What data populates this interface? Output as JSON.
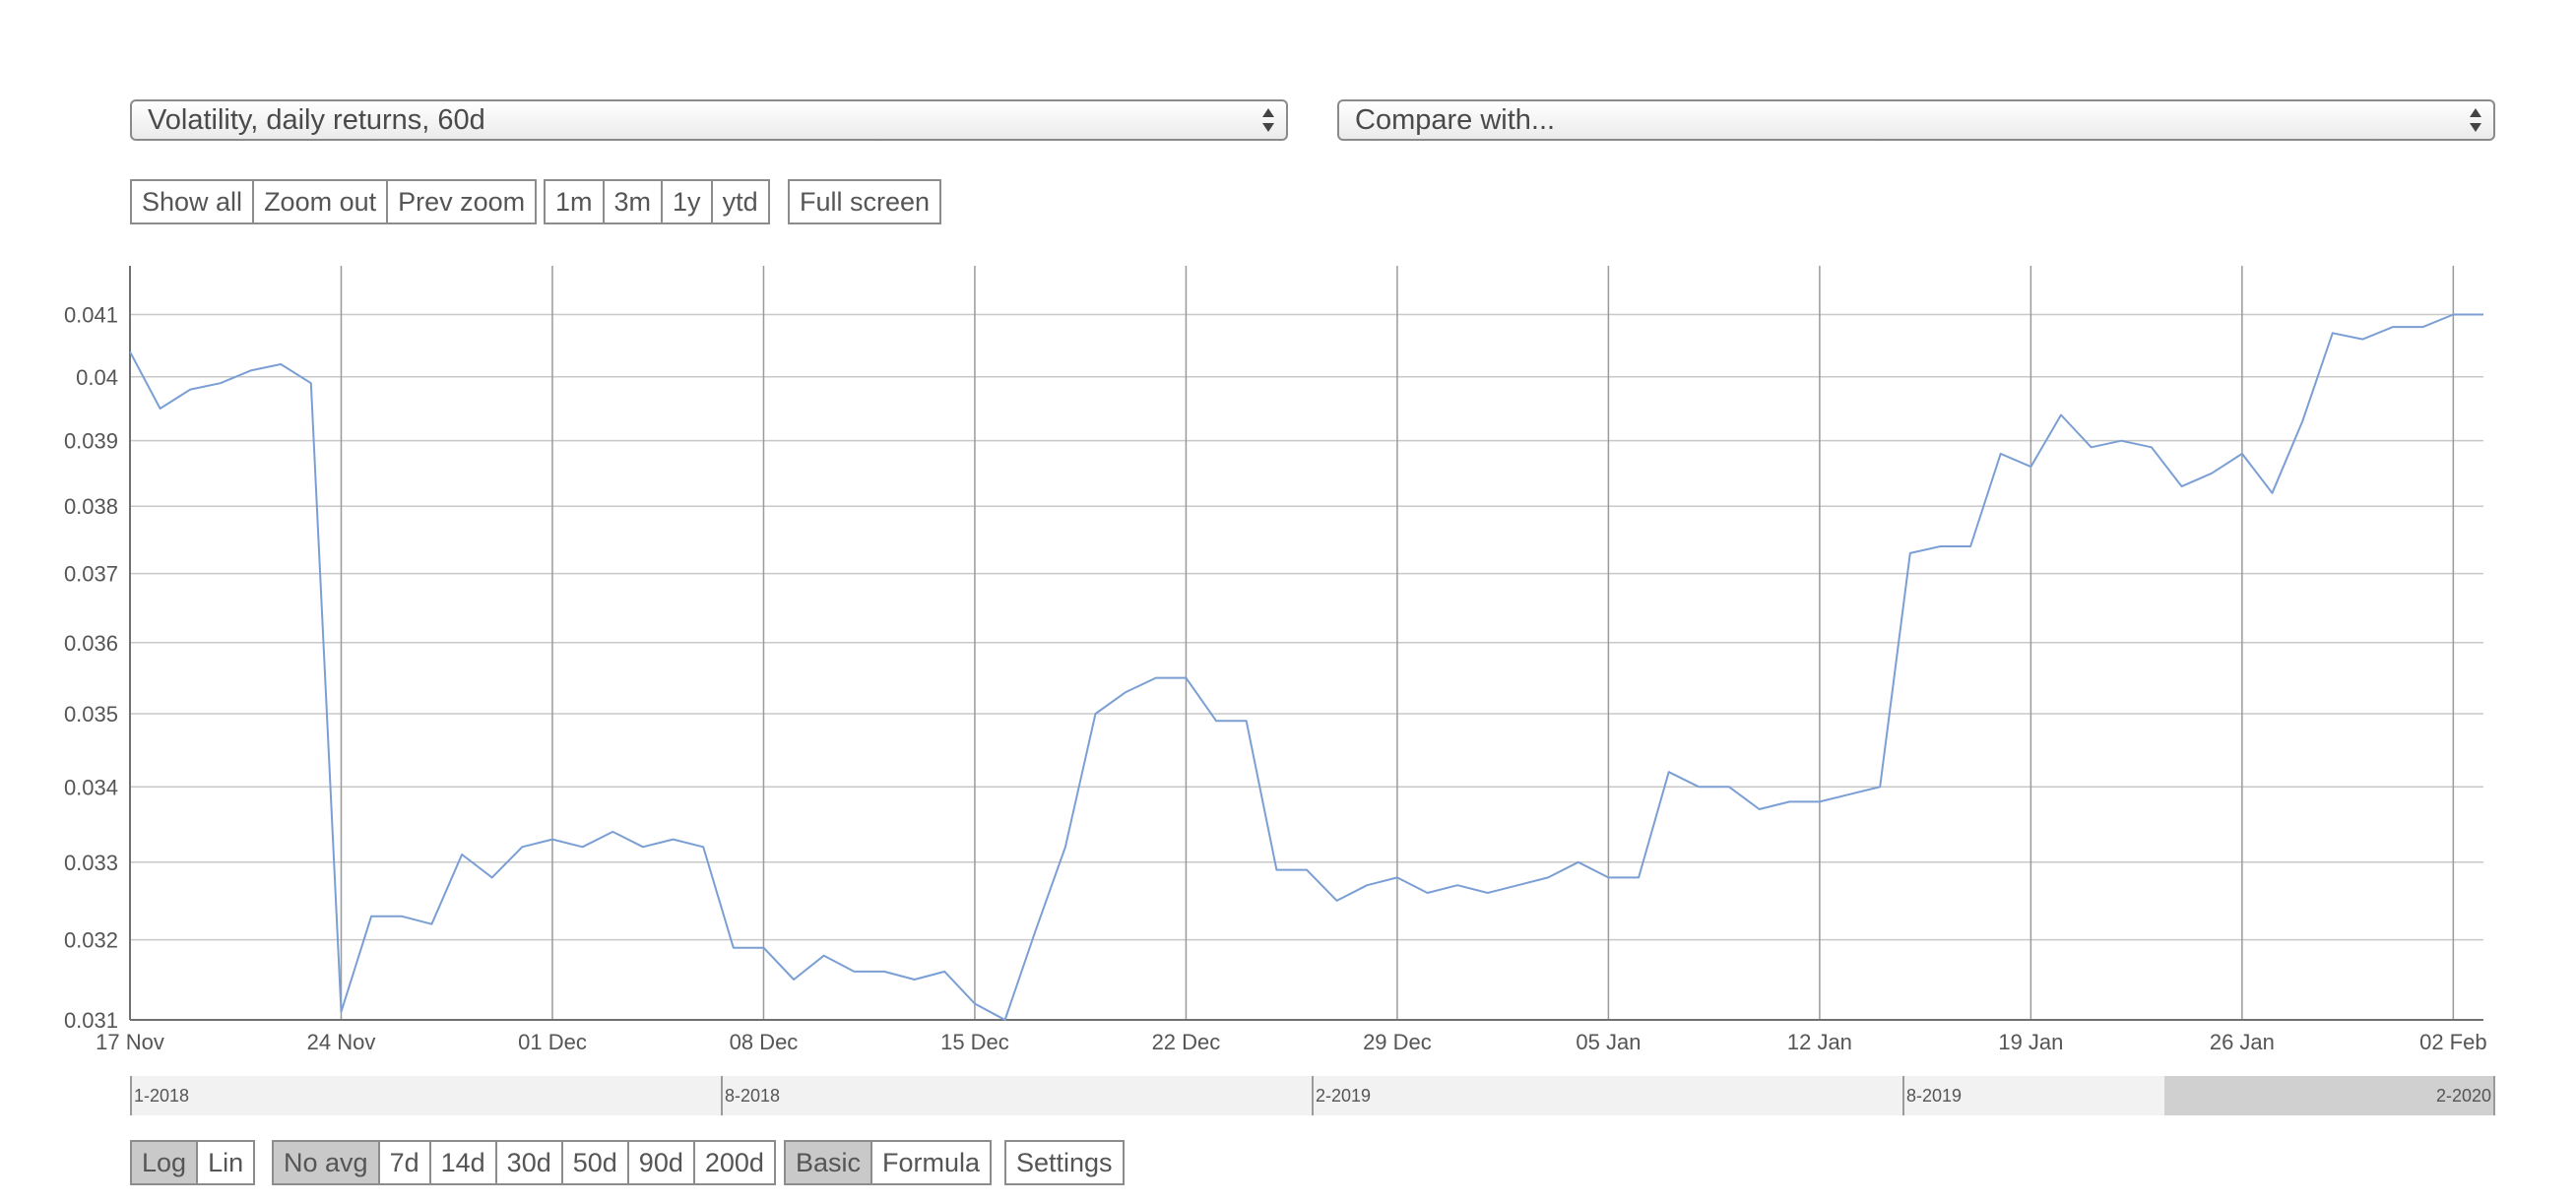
{
  "metric_select": {
    "value": "Volatility, daily returns, 60d"
  },
  "compare_select": {
    "value": "Compare with..."
  },
  "zoom_buttons": [
    "Show all",
    "Zoom out",
    "Prev zoom"
  ],
  "range_buttons": [
    "1m",
    "3m",
    "1y",
    "ytd"
  ],
  "fullscreen_button": "Full screen",
  "scale_buttons": [
    {
      "label": "Log",
      "active": true
    },
    {
      "label": "Lin",
      "active": false
    }
  ],
  "avg_buttons": [
    {
      "label": "No avg",
      "active": true
    },
    {
      "label": "7d",
      "active": false
    },
    {
      "label": "14d",
      "active": false
    },
    {
      "label": "30d",
      "active": false
    },
    {
      "label": "50d",
      "active": false
    },
    {
      "label": "90d",
      "active": false
    },
    {
      "label": "200d",
      "active": false
    }
  ],
  "mode_buttons": [
    {
      "label": "Basic",
      "active": true
    },
    {
      "label": "Formula",
      "active": false
    }
  ],
  "settings_button": "Settings",
  "navigator": {
    "labels": [
      "1-2018",
      "8-2018",
      "2-2019",
      "8-2019",
      "2-2020"
    ],
    "selection_fraction": [
      0.86,
      1.0
    ]
  },
  "colors": {
    "line": "#7b9fd4",
    "grid": "#c8c8c8",
    "selection": "#d0d0d0"
  },
  "chart_data": {
    "type": "line",
    "title": "",
    "xlabel": "",
    "ylabel": "",
    "y_scale": "log",
    "ylim": [
      0.031,
      0.0418
    ],
    "yticks": [
      0.031,
      0.032,
      0.033,
      0.034,
      0.035,
      0.036,
      0.037,
      0.038,
      0.039,
      0.04,
      0.041
    ],
    "ytick_labels": [
      "0.031",
      "0.032",
      "0.033",
      "0.034",
      "0.035",
      "0.036",
      "0.037",
      "0.038",
      "0.039",
      "0.04",
      "0.041"
    ],
    "xlim": [
      "2019-11-17",
      "2020-02-03"
    ],
    "xticks": [
      "2019-11-17",
      "2019-11-24",
      "2019-12-01",
      "2019-12-08",
      "2019-12-15",
      "2019-12-22",
      "2019-12-29",
      "2020-01-05",
      "2020-01-12",
      "2020-01-19",
      "2020-01-26",
      "2020-02-02"
    ],
    "xtick_labels": [
      "17 Nov",
      "24 Nov",
      "01 Dec",
      "08 Dec",
      "15 Dec",
      "22 Dec",
      "29 Dec",
      "05 Jan",
      "12 Jan",
      "19 Jan",
      "26 Jan",
      "02 Feb"
    ],
    "grid": true,
    "series": [
      {
        "x": [
          "2019-11-17",
          "2019-11-18",
          "2019-11-19",
          "2019-11-20",
          "2019-11-21",
          "2019-11-22",
          "2019-11-23",
          "2019-11-24",
          "2019-11-25",
          "2019-11-26",
          "2019-11-27",
          "2019-11-28",
          "2019-11-29",
          "2019-11-30",
          "2019-12-01",
          "2019-12-02",
          "2019-12-03",
          "2019-12-04",
          "2019-12-05",
          "2019-12-06",
          "2019-12-07",
          "2019-12-08",
          "2019-12-09",
          "2019-12-10",
          "2019-12-11",
          "2019-12-12",
          "2019-12-13",
          "2019-12-14",
          "2019-12-15",
          "2019-12-16",
          "2019-12-17",
          "2019-12-18",
          "2019-12-19",
          "2019-12-20",
          "2019-12-21",
          "2019-12-22",
          "2019-12-23",
          "2019-12-24",
          "2019-12-25",
          "2019-12-26",
          "2019-12-27",
          "2019-12-28",
          "2019-12-29",
          "2019-12-30",
          "2019-12-31",
          "2020-01-01",
          "2020-01-02",
          "2020-01-03",
          "2020-01-04",
          "2020-01-05",
          "2020-01-06",
          "2020-01-07",
          "2020-01-08",
          "2020-01-09",
          "2020-01-10",
          "2020-01-11",
          "2020-01-12",
          "2020-01-13",
          "2020-01-14",
          "2020-01-15",
          "2020-01-16",
          "2020-01-17",
          "2020-01-18",
          "2020-01-19",
          "2020-01-20",
          "2020-01-21",
          "2020-01-22",
          "2020-01-23",
          "2020-01-24",
          "2020-01-25",
          "2020-01-26",
          "2020-01-27",
          "2020-01-28",
          "2020-01-29",
          "2020-01-30",
          "2020-01-31",
          "2020-02-01",
          "2020-02-02",
          "2020-02-03"
        ],
        "values": [
          0.0404,
          0.0395,
          0.0398,
          0.0399,
          0.0401,
          0.0402,
          0.0399,
          0.0311,
          0.0323,
          0.0323,
          0.0322,
          0.0331,
          0.0328,
          0.0332,
          0.0333,
          0.0332,
          0.0334,
          0.0332,
          0.0333,
          0.0332,
          0.0319,
          0.0319,
          0.0315,
          0.0318,
          0.0316,
          0.0316,
          0.0315,
          0.0316,
          0.0312,
          0.031,
          0.0321,
          0.0332,
          0.035,
          0.0353,
          0.0355,
          0.0355,
          0.0349,
          0.0349,
          0.0329,
          0.0329,
          0.0325,
          0.0327,
          0.0328,
          0.0326,
          0.0327,
          0.0326,
          0.0327,
          0.0328,
          0.033,
          0.0328,
          0.0328,
          0.0342,
          0.034,
          0.034,
          0.0337,
          0.0338,
          0.0338,
          0.0339,
          0.034,
          0.0373,
          0.0374,
          0.0374,
          0.0388,
          0.0386,
          0.0394,
          0.0389,
          0.039,
          0.0389,
          0.0383,
          0.0385,
          0.0388,
          0.0382,
          0.0393,
          0.0407,
          0.0406,
          0.0408,
          0.0408,
          0.041,
          0.041
        ]
      }
    ]
  }
}
